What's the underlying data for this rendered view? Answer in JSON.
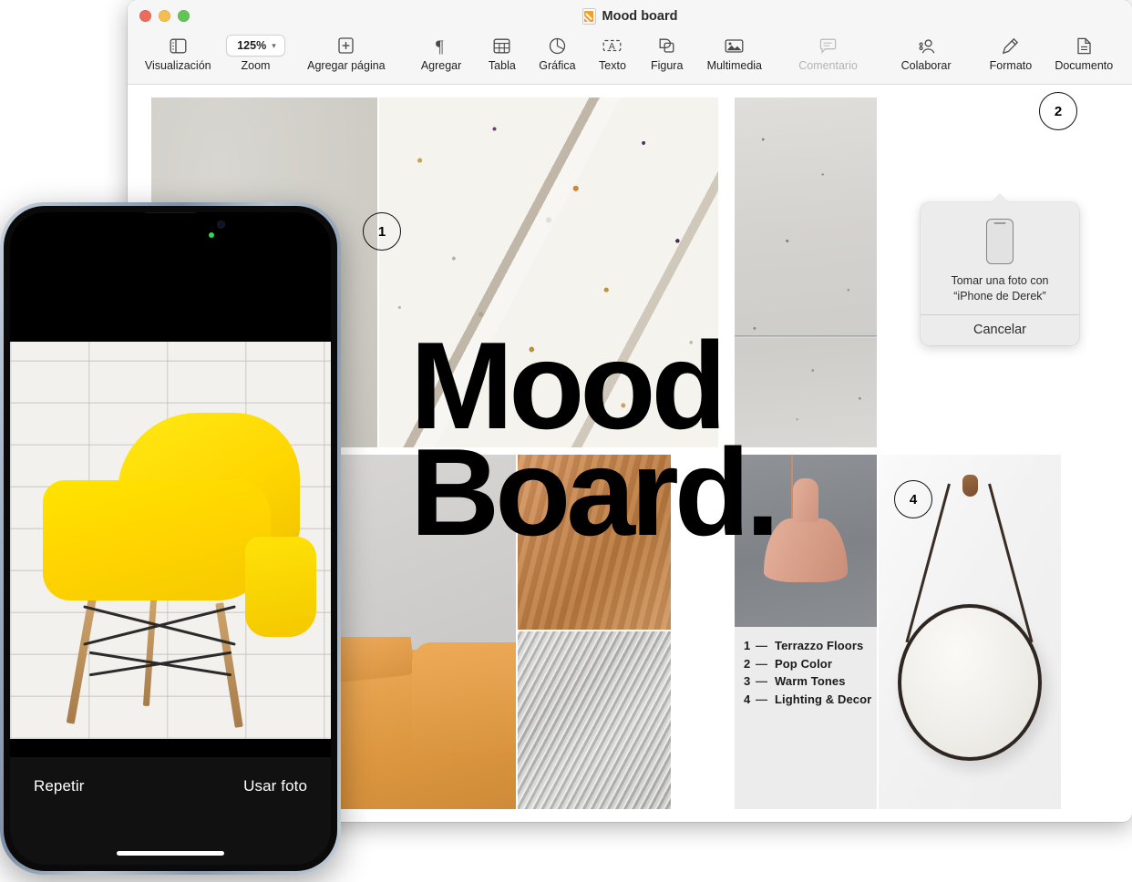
{
  "window": {
    "title": "Mood board",
    "traffic_lights": [
      "close",
      "minimize",
      "zoom"
    ]
  },
  "toolbar": {
    "items": [
      {
        "label": "Visualización",
        "icon": "sidebar-icon",
        "dim": false
      },
      {
        "label": "Zoom",
        "icon": "zoom-popup",
        "value": "125%",
        "dim": false
      },
      {
        "label": "Agregar página",
        "icon": "add-page-icon",
        "dim": false
      },
      {
        "label": "Agregar",
        "icon": "paragraph-icon",
        "dim": false
      },
      {
        "label": "Tabla",
        "icon": "table-icon",
        "dim": false
      },
      {
        "label": "Gráfica",
        "icon": "chart-icon",
        "dim": false
      },
      {
        "label": "Texto",
        "icon": "text-box-icon",
        "dim": false
      },
      {
        "label": "Figura",
        "icon": "shape-icon",
        "dim": false
      },
      {
        "label": "Multimedia",
        "icon": "media-icon",
        "dim": false
      },
      {
        "label": "Comentario",
        "icon": "comment-icon",
        "dim": true
      },
      {
        "label": "Colaborar",
        "icon": "collaborate-icon",
        "dim": false
      },
      {
        "label": "Formato",
        "icon": "format-brush-icon",
        "dim": false
      },
      {
        "label": "Documento",
        "icon": "document-icon",
        "dim": false
      }
    ]
  },
  "document": {
    "headline": "Mood\nBoard.",
    "markers": [
      {
        "id": "m1",
        "number": "1"
      },
      {
        "id": "m2",
        "number": "2"
      },
      {
        "id": "m4",
        "number": "4"
      }
    ],
    "legend": [
      {
        "num": "1",
        "dash": "—",
        "label": "Terrazzo Floors"
      },
      {
        "num": "2",
        "dash": "—",
        "label": "Pop Color"
      },
      {
        "num": "3",
        "dash": "—",
        "label": "Warm Tones"
      },
      {
        "num": "4",
        "dash": "—",
        "label": "Lighting & Decor"
      }
    ],
    "images": [
      {
        "name": "grey-wall-photo"
      },
      {
        "name": "terrazzo-slab-photo"
      },
      {
        "name": "concrete-wall-photo"
      },
      {
        "name": "tan-leather-sofa-photo"
      },
      {
        "name": "wood-grain-photo"
      },
      {
        "name": "grey-fur-rug-photo"
      },
      {
        "name": "pink-pendant-lamp-photo"
      },
      {
        "name": "round-hanging-mirror-photo"
      }
    ]
  },
  "popover": {
    "message": "Tomar una foto con\n“iPhone de Derek”",
    "cancel_label": "Cancelar",
    "device_icon": "iphone-icon"
  },
  "iphone": {
    "retake_label": "Repetir",
    "use_photo_label": "Usar foto",
    "status": {
      "camera_in_use_dot": "green"
    },
    "preview": "yellow-chair-white-brick-photo"
  },
  "colors": {
    "accent_yellow": "#ffd400",
    "window_chrome": "#f6f6f6",
    "popover_bg": "#ececec",
    "legend_panel": "#ececec",
    "headline": "#000000",
    "green_dot": "#32d74b"
  }
}
